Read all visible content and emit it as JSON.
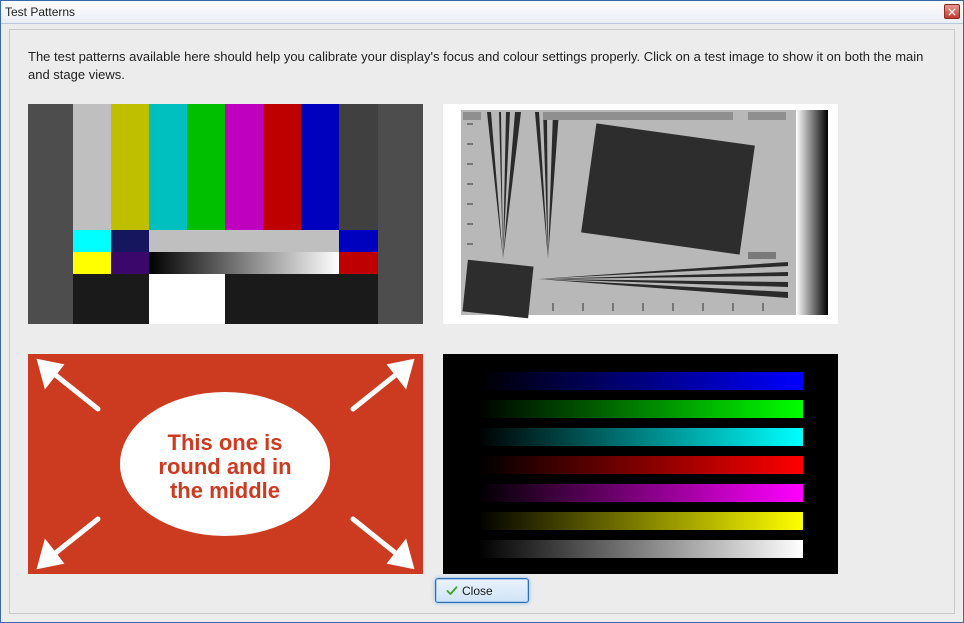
{
  "window": {
    "title": "Test Patterns"
  },
  "description": "The test patterns available here should help you calibrate your display's focus and colour settings properly. Click on a test image to show it on both the main and stage views.",
  "thumbs": {
    "smpte": {
      "name": "colour-bars-pattern"
    },
    "focus": {
      "name": "focus-chart-pattern"
    },
    "geometry": {
      "name": "geometry-pattern",
      "line1": "This one is",
      "line2": "round and in",
      "line3": "the middle"
    },
    "gradients": {
      "name": "colour-gradient-pattern"
    }
  },
  "buttons": {
    "close": "Close"
  },
  "icons": {
    "close_x": "close-icon",
    "tick": "check-icon"
  }
}
